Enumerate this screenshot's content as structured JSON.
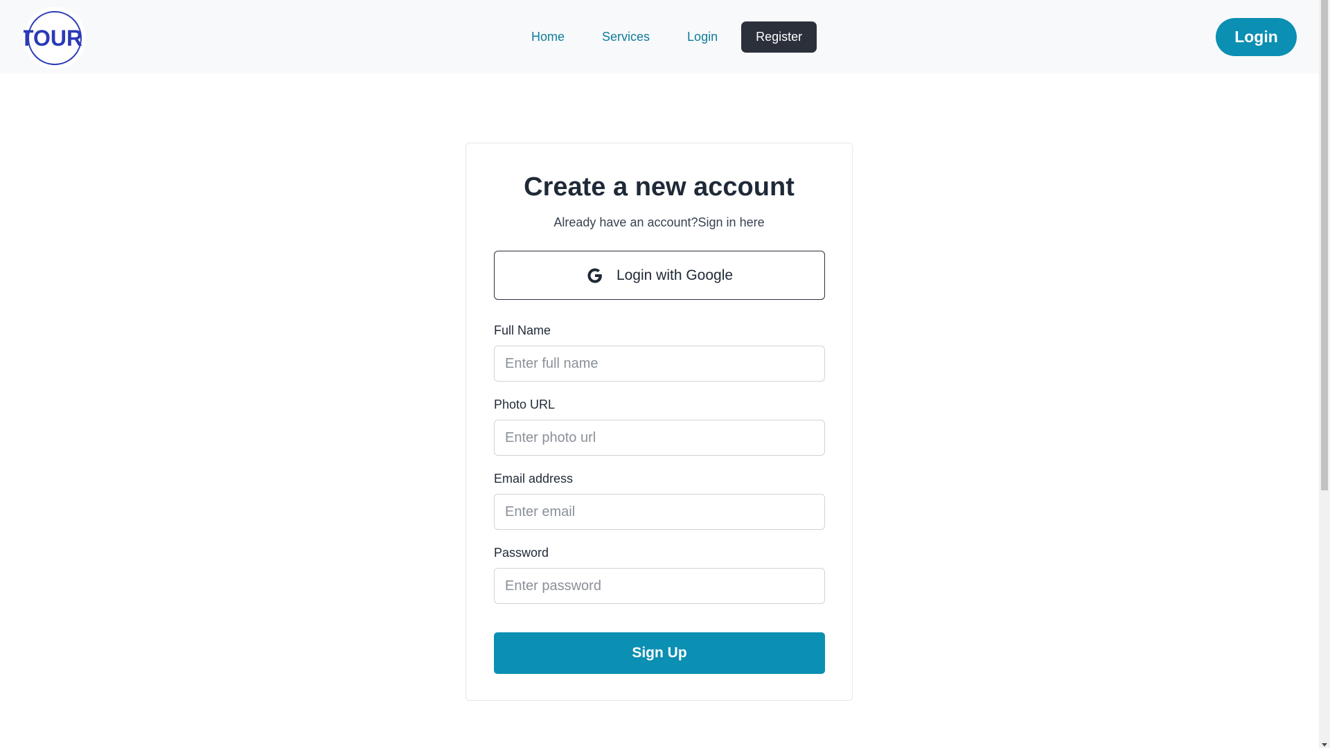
{
  "nav": {
    "logo_text": "TOUR",
    "links": [
      {
        "label": "Home"
      },
      {
        "label": "Services"
      },
      {
        "label": "Login"
      },
      {
        "label": "Register"
      }
    ],
    "login_button": "Login"
  },
  "form": {
    "title": "Create a new account",
    "subtitle_prefix": "Already have an account?",
    "subtitle_link": "Sign in here",
    "google_button": "Login with Google",
    "fields": [
      {
        "label": "Full Name",
        "placeholder": "Enter full name",
        "value": ""
      },
      {
        "label": "Photo URL",
        "placeholder": "Enter photo url",
        "value": ""
      },
      {
        "label": "Email address",
        "placeholder": "Enter email",
        "value": ""
      },
      {
        "label": "Password",
        "placeholder": "Enter password",
        "value": ""
      }
    ],
    "submit_button": "Sign Up"
  },
  "colors": {
    "accent": "#0b8fb2",
    "nav_link": "#0e7c9a",
    "active_nav_bg": "#2b303b",
    "logo": "#2a3ab8"
  },
  "icons": {
    "logo": "tour-logo-icon",
    "google": "google-icon"
  }
}
